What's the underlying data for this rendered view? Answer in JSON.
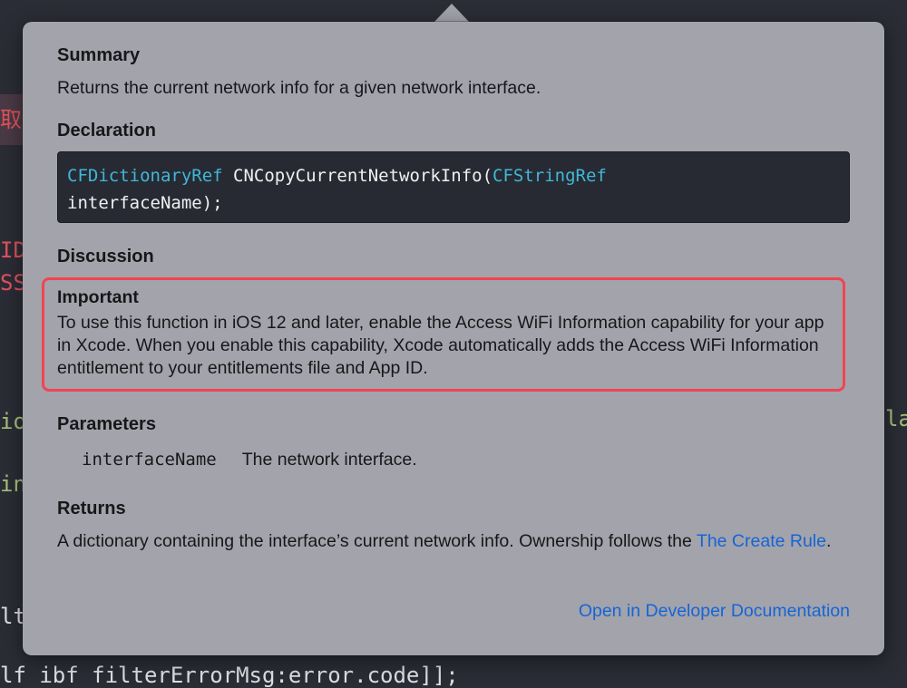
{
  "background": {
    "fragments": [
      {
        "id": "bg-char-1",
        "text": "取"
      },
      {
        "id": "bg-char-2",
        "text": "ID"
      },
      {
        "id": "bg-char-3",
        "text": "SS"
      },
      {
        "id": "bg-char-4",
        "text": "io"
      },
      {
        "id": "bg-char-5",
        "text": "in"
      },
      {
        "id": "bg-char-6",
        "text": "lt"
      },
      {
        "id": "bg-char-7",
        "text": "la"
      },
      {
        "id": "bg-char-8",
        "text": "lf ibf filterErrorMsg:error.code]];"
      }
    ]
  },
  "popover": {
    "summary": {
      "title": "Summary",
      "text": "Returns the current network info for a given network interface."
    },
    "declaration": {
      "title": "Declaration",
      "line1_type": "CFDictionaryRef",
      "line1_func": " CNCopyCurrentNetworkInfo(",
      "line1_param_type": "CFStringRef",
      "line2": "interfaceName);"
    },
    "discussion": {
      "title": "Discussion",
      "important_title": "Important",
      "important_text": "To use this function in iOS 12 and later, enable the Access WiFi Information capability for your app in Xcode. When you enable this capability, Xcode automatically adds the Access WiFi Information entitlement to your entitlements file and App ID."
    },
    "parameters": {
      "title": "Parameters",
      "items": [
        {
          "name": "interfaceName",
          "description": "The network interface."
        }
      ]
    },
    "returns": {
      "title": "Returns",
      "text": "A dictionary containing the interface’s current network info. Ownership follows the ",
      "link": "The Create Rule",
      "end": "."
    },
    "open_docs_label": "Open in Developer Documentation"
  },
  "colors": {
    "popover_bg": "#a3a3ab",
    "code_bg": "#272a33",
    "code_type": "#41b7d6",
    "highlight_border": "#f24452",
    "link": "#1565d6"
  }
}
